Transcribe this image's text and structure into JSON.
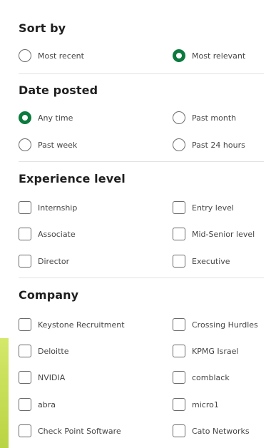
{
  "sort_by": {
    "title": "Sort by",
    "options": [
      {
        "label": "Most recent",
        "selected": false
      },
      {
        "label": "Most relevant",
        "selected": true
      }
    ]
  },
  "date_posted": {
    "title": "Date posted",
    "options": [
      {
        "label": "Any time",
        "selected": true
      },
      {
        "label": "Past month",
        "selected": false
      },
      {
        "label": "Past week",
        "selected": false
      },
      {
        "label": "Past 24 hours",
        "selected": false
      }
    ]
  },
  "experience_level": {
    "title": "Experience level",
    "options": [
      {
        "label": "Internship",
        "checked": false
      },
      {
        "label": "Entry level",
        "checked": false
      },
      {
        "label": "Associate",
        "checked": false
      },
      {
        "label": "Mid-Senior level",
        "checked": false
      },
      {
        "label": "Director",
        "checked": false
      },
      {
        "label": "Executive",
        "checked": false
      }
    ]
  },
  "company": {
    "title": "Company",
    "options": [
      {
        "label": "Keystone Recruitment",
        "checked": false
      },
      {
        "label": "Crossing Hurdles",
        "checked": false
      },
      {
        "label": "Deloitte",
        "checked": false
      },
      {
        "label": "KPMG Israel",
        "checked": false
      },
      {
        "label": "NVIDIA",
        "checked": false
      },
      {
        "label": "comblack",
        "checked": false
      },
      {
        "label": "abra",
        "checked": false
      },
      {
        "label": "micro1",
        "checked": false
      },
      {
        "label": "Check Point Software",
        "checked": false
      },
      {
        "label": "Cato Networks",
        "checked": false
      }
    ]
  },
  "colors": {
    "selected_accent": "#0b7a3e",
    "side_stripe": "#c8df55"
  }
}
